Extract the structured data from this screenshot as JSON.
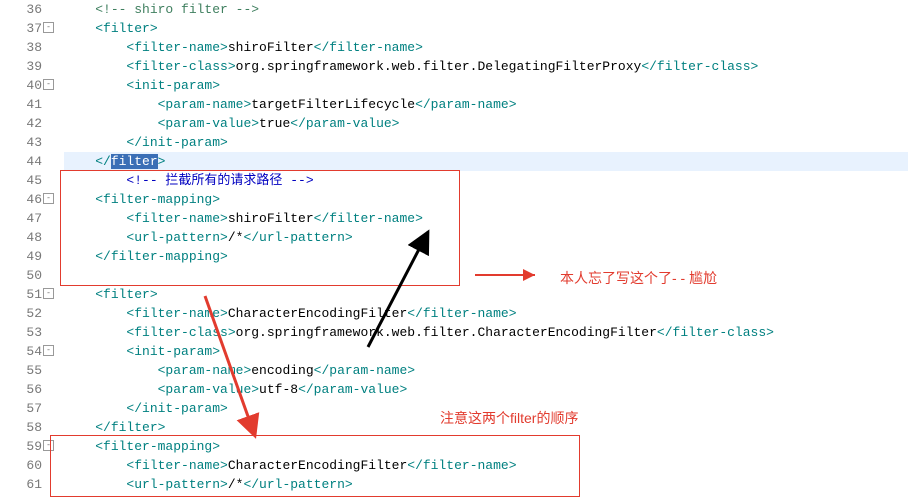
{
  "lines": [
    {
      "num": "36",
      "fold": "",
      "hl": false,
      "seg": [
        {
          "cls": "",
          "ind": 4
        },
        {
          "cls": "c-comment",
          "t": "<!-- shiro filter -->"
        }
      ]
    },
    {
      "num": "37",
      "fold": "-",
      "hl": false,
      "seg": [
        {
          "cls": "",
          "ind": 4
        },
        {
          "cls": "c-tag",
          "t": "<filter>"
        }
      ]
    },
    {
      "num": "38",
      "fold": "",
      "hl": false,
      "seg": [
        {
          "cls": "",
          "ind": 8
        },
        {
          "cls": "c-tag",
          "t": "<filter-name>"
        },
        {
          "cls": "c-txt",
          "t": "shiroFilter"
        },
        {
          "cls": "c-tag",
          "t": "</filter-name>"
        }
      ]
    },
    {
      "num": "39",
      "fold": "",
      "hl": false,
      "seg": [
        {
          "cls": "",
          "ind": 8
        },
        {
          "cls": "c-tag",
          "t": "<filter-class>"
        },
        {
          "cls": "c-txt",
          "t": "org.springframework.web.filter.DelegatingFilterProxy"
        },
        {
          "cls": "c-tag",
          "t": "</filter-class>"
        }
      ]
    },
    {
      "num": "40",
      "fold": "-",
      "hl": false,
      "seg": [
        {
          "cls": "",
          "ind": 8
        },
        {
          "cls": "c-tag",
          "t": "<init-param>"
        }
      ]
    },
    {
      "num": "41",
      "fold": "",
      "hl": false,
      "seg": [
        {
          "cls": "",
          "ind": 12
        },
        {
          "cls": "c-tag",
          "t": "<param-name>"
        },
        {
          "cls": "c-txt",
          "t": "targetFilterLifecycle"
        },
        {
          "cls": "c-tag",
          "t": "</param-name>"
        }
      ]
    },
    {
      "num": "42",
      "fold": "",
      "hl": false,
      "seg": [
        {
          "cls": "",
          "ind": 12
        },
        {
          "cls": "c-tag",
          "t": "<param-value>"
        },
        {
          "cls": "c-txt",
          "t": "true"
        },
        {
          "cls": "c-tag",
          "t": "</param-value>"
        }
      ]
    },
    {
      "num": "43",
      "fold": "",
      "hl": false,
      "seg": [
        {
          "cls": "",
          "ind": 8
        },
        {
          "cls": "c-tag",
          "t": "</init-param>"
        }
      ]
    },
    {
      "num": "44",
      "fold": "",
      "hl": true,
      "seg": [
        {
          "cls": "",
          "ind": 4
        },
        {
          "cls": "c-tag",
          "t": "</"
        },
        {
          "cls": "c-sel",
          "t": "filter"
        },
        {
          "cls": "c-tag",
          "t": ">"
        }
      ]
    },
    {
      "num": "45",
      "fold": "",
      "hl": false,
      "seg": [
        {
          "cls": "",
          "ind": 8
        },
        {
          "cls": "c-cn",
          "t": "<!-- 拦截所有的请求路径 -->"
        }
      ]
    },
    {
      "num": "46",
      "fold": "-",
      "hl": false,
      "seg": [
        {
          "cls": "",
          "ind": 4
        },
        {
          "cls": "c-tag",
          "t": "<filter-mapping>"
        }
      ]
    },
    {
      "num": "47",
      "fold": "",
      "hl": false,
      "seg": [
        {
          "cls": "",
          "ind": 8
        },
        {
          "cls": "c-tag",
          "t": "<filter-name>"
        },
        {
          "cls": "c-txt",
          "t": "shiroFilter"
        },
        {
          "cls": "c-tag",
          "t": "</filter-name>"
        }
      ]
    },
    {
      "num": "48",
      "fold": "",
      "hl": false,
      "seg": [
        {
          "cls": "",
          "ind": 8
        },
        {
          "cls": "c-tag",
          "t": "<url-pattern>"
        },
        {
          "cls": "c-txt",
          "t": "/*"
        },
        {
          "cls": "c-tag",
          "t": "</url-pattern>"
        }
      ]
    },
    {
      "num": "49",
      "fold": "",
      "hl": false,
      "seg": [
        {
          "cls": "",
          "ind": 4
        },
        {
          "cls": "c-tag",
          "t": "</filter-mapping>"
        }
      ]
    },
    {
      "num": "50",
      "fold": "",
      "hl": false,
      "seg": [
        {
          "cls": "",
          "ind": 4
        },
        {
          "cls": "",
          "t": ""
        }
      ]
    },
    {
      "num": "51",
      "fold": "-",
      "hl": false,
      "seg": [
        {
          "cls": "",
          "ind": 4
        },
        {
          "cls": "c-tag",
          "t": "<filter>"
        }
      ]
    },
    {
      "num": "52",
      "fold": "",
      "hl": false,
      "seg": [
        {
          "cls": "",
          "ind": 8
        },
        {
          "cls": "c-tag",
          "t": "<filter-name>"
        },
        {
          "cls": "c-txt",
          "t": "CharacterEncodingFilter"
        },
        {
          "cls": "c-tag",
          "t": "</filter-name>"
        }
      ]
    },
    {
      "num": "53",
      "fold": "",
      "hl": false,
      "seg": [
        {
          "cls": "",
          "ind": 8
        },
        {
          "cls": "c-tag",
          "t": "<filter-class>"
        },
        {
          "cls": "c-txt",
          "t": "org.springframework.web.filter.CharacterEncodingFilter"
        },
        {
          "cls": "c-tag",
          "t": "</filter-class>"
        }
      ]
    },
    {
      "num": "54",
      "fold": "-",
      "hl": false,
      "seg": [
        {
          "cls": "",
          "ind": 8
        },
        {
          "cls": "c-tag",
          "t": "<init-param>"
        }
      ]
    },
    {
      "num": "55",
      "fold": "",
      "hl": false,
      "seg": [
        {
          "cls": "",
          "ind": 12
        },
        {
          "cls": "c-tag",
          "t": "<param-name>"
        },
        {
          "cls": "c-txt",
          "t": "encoding"
        },
        {
          "cls": "c-tag",
          "t": "</param-name>"
        }
      ]
    },
    {
      "num": "56",
      "fold": "",
      "hl": false,
      "seg": [
        {
          "cls": "",
          "ind": 12
        },
        {
          "cls": "c-tag",
          "t": "<param-value>"
        },
        {
          "cls": "c-txt",
          "t": "utf-8"
        },
        {
          "cls": "c-tag",
          "t": "</param-value>"
        }
      ]
    },
    {
      "num": "57",
      "fold": "",
      "hl": false,
      "seg": [
        {
          "cls": "",
          "ind": 8
        },
        {
          "cls": "c-tag",
          "t": "</init-param>"
        }
      ]
    },
    {
      "num": "58",
      "fold": "",
      "hl": false,
      "seg": [
        {
          "cls": "",
          "ind": 4
        },
        {
          "cls": "c-tag",
          "t": "</filter>"
        }
      ]
    },
    {
      "num": "59",
      "fold": "-",
      "hl": false,
      "seg": [
        {
          "cls": "",
          "ind": 4
        },
        {
          "cls": "c-tag",
          "t": "<filter-mapping>"
        }
      ]
    },
    {
      "num": "60",
      "fold": "",
      "hl": false,
      "seg": [
        {
          "cls": "",
          "ind": 8
        },
        {
          "cls": "c-tag",
          "t": "<filter-name>"
        },
        {
          "cls": "c-txt",
          "t": "CharacterEncodingFilter"
        },
        {
          "cls": "c-tag",
          "t": "</filter-name>"
        }
      ]
    },
    {
      "num": "61",
      "fold": "",
      "hl": false,
      "seg": [
        {
          "cls": "",
          "ind": 8
        },
        {
          "cls": "c-tag",
          "t": "<url-pattern>"
        },
        {
          "cls": "c-txt",
          "t": "/*"
        },
        {
          "cls": "c-tag",
          "t": "</url-pattern>"
        }
      ]
    }
  ],
  "annotations": {
    "note1": "本人忘了写这个了- - 尴尬",
    "note2": "注意这两个filter的顺序"
  }
}
